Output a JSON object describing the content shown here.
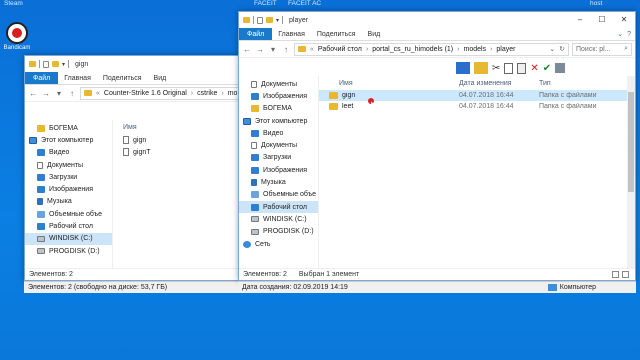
{
  "desktop": {
    "top_items": [
      "Steam",
      "FACEIT",
      "FACEIT AC",
      "host",
      "Сетевое"
    ],
    "bandicam_label": "Bandicam"
  },
  "left_window": {
    "title": "gign",
    "ribbon": {
      "file": "Файл",
      "tabs": [
        "Главная",
        "Поделиться",
        "Вид"
      ]
    },
    "address": {
      "crumbs": [
        "Counter-Strike 1.6 Original",
        "cstrike",
        "mo"
      ]
    },
    "nav_items": [
      {
        "label": "БОГЕМА",
        "icon": "folder-icon",
        "indent": true
      },
      {
        "label": "Этот компьютер",
        "icon": "computer-icon",
        "indent": false
      },
      {
        "label": "Видео",
        "icon": "video-icon",
        "indent": true
      },
      {
        "label": "Документы",
        "icon": "documents-icon",
        "indent": true
      },
      {
        "label": "Загрузки",
        "icon": "downloads-icon",
        "indent": true
      },
      {
        "label": "Изображения",
        "icon": "pictures-icon",
        "indent": true
      },
      {
        "label": "Музыка",
        "icon": "music-icon",
        "indent": true
      },
      {
        "label": "Объемные объе",
        "icon": "3d-objects-icon",
        "indent": true
      },
      {
        "label": "Рабочий стол",
        "icon": "desktop-icon",
        "indent": true
      },
      {
        "label": "WINDISK (C:)",
        "icon": "drive-icon",
        "indent": true,
        "selected": true
      },
      {
        "label": "PROGDISK (D:)",
        "icon": "drive-icon",
        "indent": true
      }
    ],
    "columns": [
      "Имя"
    ],
    "files": [
      "gign",
      "gignT"
    ],
    "status": "Элементов: 2"
  },
  "left_lower_status": "Элементов: 2 (свободно на диске: 53,7 ГБ)",
  "right_window": {
    "title": "player",
    "ribbon": {
      "file": "Файл",
      "tabs": [
        "Главная",
        "Поделиться",
        "Вид"
      ]
    },
    "address": {
      "crumbs": [
        "Рабочий стол",
        "portal_cs_ru_himodels (1)",
        "models",
        "player"
      ]
    },
    "search_placeholder": "Поиск: pl...",
    "nav_items": [
      {
        "label": "Документы",
        "icon": "documents-icon",
        "indent": true
      },
      {
        "label": "Изображения",
        "icon": "pictures-icon",
        "indent": true
      },
      {
        "label": "БОГЕМА",
        "icon": "folder-icon",
        "indent": true
      },
      {
        "label": "Этот компьютер",
        "icon": "computer-icon",
        "indent": false
      },
      {
        "label": "Видео",
        "icon": "video-icon",
        "indent": true
      },
      {
        "label": "Документы",
        "icon": "documents-icon",
        "indent": true
      },
      {
        "label": "Загрузки",
        "icon": "downloads-icon",
        "indent": true
      },
      {
        "label": "Изображения",
        "icon": "pictures-icon",
        "indent": true
      },
      {
        "label": "Музыка",
        "icon": "music-icon",
        "indent": true
      },
      {
        "label": "Объемные объе",
        "icon": "3d-objects-icon",
        "indent": true
      },
      {
        "label": "Рабочий стол",
        "icon": "desktop-icon",
        "indent": true,
        "selected": true
      },
      {
        "label": "WINDISK (C:)",
        "icon": "drive-icon",
        "indent": true
      },
      {
        "label": "PROGDISK (D:)",
        "icon": "drive-icon",
        "indent": true
      },
      {
        "label": "Сеть",
        "icon": "network-icon",
        "indent": false
      }
    ],
    "columns": {
      "name": "Имя",
      "date": "Дата изменения",
      "type": "Тип"
    },
    "rows": [
      {
        "name": "gign",
        "date": "04.07.2018 16:44",
        "type": "Папка с файлами",
        "selected": true
      },
      {
        "name": "leet",
        "date": "04.07.2018 16:44",
        "type": "Папка с файлами",
        "selected": false
      }
    ],
    "status": {
      "count": "Элементов: 2",
      "selected": "Выбран 1 элемент"
    }
  },
  "right_lower_status": {
    "created": "Дата создания: 02.09.2019 14:19",
    "location": "Компьютер"
  }
}
